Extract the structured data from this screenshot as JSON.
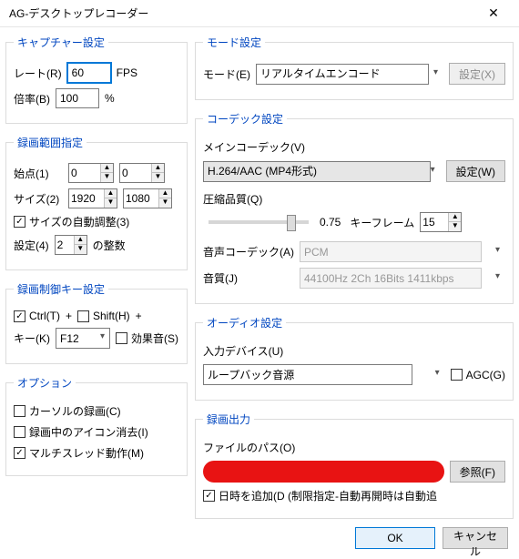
{
  "window": {
    "title": "AG-デスクトップレコーダー"
  },
  "capture": {
    "legend": "キャプチャー設定",
    "rate_label": "レート(R)",
    "rate_value": "60",
    "rate_unit": "FPS",
    "mult_label": "倍率(B)",
    "mult_value": "100",
    "mult_unit": "%"
  },
  "range": {
    "legend": "録画範囲指定",
    "origin_label": "始点(1)",
    "origin_x": "0",
    "origin_y": "0",
    "size_label": "サイズ(2)",
    "size_w": "1920",
    "size_h": "1080",
    "autosize_label": "サイズの自動調整(3)",
    "autosize_checked": true,
    "setting_label": "設定(4)",
    "setting_value": "2",
    "setting_suffix": "の整数"
  },
  "hotkey": {
    "legend": "録画制御キー設定",
    "ctrl_label": "Ctrl(T)",
    "ctrl_checked": true,
    "shift_label": "Shift(H)",
    "shift_checked": false,
    "plus": "+",
    "key_label": "キー(K)",
    "key_value": "F12",
    "sound_label": "効果音(S)",
    "sound_checked": false
  },
  "options": {
    "legend": "オプション",
    "cursor_label": "カーソルの録画(C)",
    "cursor_checked": false,
    "hideicon_label": "録画中のアイコン消去(I)",
    "hideicon_checked": false,
    "multithread_label": "マルチスレッド動作(M)",
    "multithread_checked": true
  },
  "mode": {
    "legend": "モード設定",
    "label": "モード(E)",
    "value": "リアルタイムエンコード",
    "settings_btn": "設定(X)"
  },
  "codec": {
    "legend": "コーデック設定",
    "main_label": "メインコーデック(V)",
    "main_value": "H.264/AAC (MP4形式)",
    "main_btn": "設定(W)",
    "quality_label": "圧縮品質(Q)",
    "quality_value": "0.75",
    "keyframe_label": "キーフレーム",
    "keyframe_value": "15",
    "audio_codec_label": "音声コーデック(A)",
    "audio_codec_value": "PCM",
    "audio_quality_label": "音質(J)",
    "audio_quality_value": "44100Hz 2Ch 16Bits 1411kbps"
  },
  "audio": {
    "legend": "オーディオ設定",
    "device_label": "入力デバイス(U)",
    "device_value": "ループバック音源",
    "agc_label": "AGC(G)",
    "agc_checked": false
  },
  "output": {
    "legend": "録画出力",
    "path_label": "ファイルのパス(O)",
    "browse_btn": "参照(F)",
    "datetime_label": "日時を追加(D (制限指定-自動再開時は自動追",
    "datetime_checked": true
  },
  "footer": {
    "ok": "OK",
    "cancel": "キャンセル"
  }
}
